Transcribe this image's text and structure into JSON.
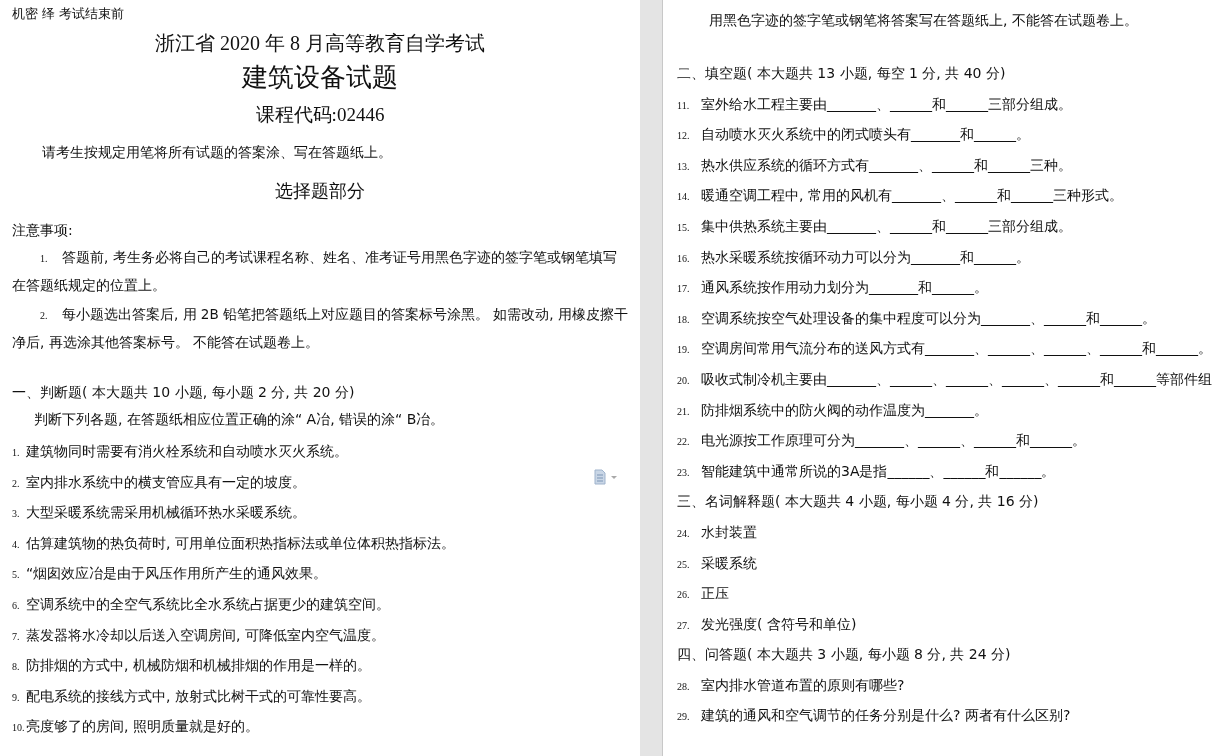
{
  "left_page": {
    "header_note": "机密  绎  考试结束前",
    "exam_title": "浙江省 2020 年 8 月高等教育自学考试",
    "subject_title": "建筑设备试题",
    "course_code": "课程代码:02446",
    "instruction": "请考生按规定用笔将所有试题的答案涂、写在答题纸上。",
    "part_title": "选择题部分",
    "notes_heading": "注意事项:",
    "notes": [
      {
        "number": "1.",
        "text": "答题前, 考生务必将自己的考试课程名称、姓名、准考证号用黑色字迹的签字笔或钢笔填写在答题纸规定的位置上。"
      },
      {
        "number": "2.",
        "text": "每小题选出答案后, 用 2B 铅笔把答题纸上对应题目的答案标号涂黑。 如需改动, 用橡皮擦干净后, 再选涂其他答案标号。 不能答在试题卷上。"
      }
    ],
    "section_heading": "一、判断题( 本大题共 10 小题, 每小题 2 分, 共 20 分)",
    "section_instruction": "判断下列各题, 在答题纸相应位置正确的涂“ A冶, 错误的涂“ B冶。",
    "questions": [
      {
        "number": "1.",
        "text": "建筑物同时需要有消火栓系统和自动喷水灭火系统。"
      },
      {
        "number": "2.",
        "text": "室内排水系统中的横支管应具有一定的坡度。"
      },
      {
        "number": "3.",
        "text": "大型采暖系统需采用机械循环热水采暖系统。"
      },
      {
        "number": "4.",
        "text": "估算建筑物的热负荷时, 可用单位面积热指标法或单位体积热指标法。"
      },
      {
        "number": "5.",
        "text": "“烟囱效应冶是由于风压作用所产生的通风效果。"
      },
      {
        "number": "6.",
        "text": "空调系统中的全空气系统比全水系统占据更少的建筑空间。"
      },
      {
        "number": "7.",
        "text": "蒸发器将水冷却以后送入空调房间, 可降低室内空气温度。"
      },
      {
        "number": "8.",
        "text": "防排烟的方式中, 机械防烟和机械排烟的作用是一样的。"
      },
      {
        "number": "9.",
        "text": "配电系统的接线方式中, 放射式比树干式的可靠性要高。"
      },
      {
        "number": "10.",
        "text": "亮度够了的房间, 照明质量就是好的。"
      }
    ]
  },
  "right_page": {
    "note": "用黑色字迹的签字笔或钢笔将答案写在答题纸上, 不能答在试题卷上。",
    "sections": [
      {
        "heading": "二、填空题( 本大题共 13 小题, 每空 1 分, 共 40 分)",
        "questions": [
          {
            "number": "11.",
            "text": "室外给水工程主要由_______、______和______三部分组成。"
          },
          {
            "number": "12.",
            "text": "自动喷水灭火系统中的闭式喷头有_______和______。"
          },
          {
            "number": "13.",
            "text": "热水供应系统的循环方式有_______、______和______三种。"
          },
          {
            "number": "14.",
            "text": "暖通空调工程中, 常用的风机有_______、______和______三种形式。"
          },
          {
            "number": "15.",
            "text": "集中供热系统主要由_______、______和______三部分组成。"
          },
          {
            "number": "16.",
            "text": "热水采暖系统按循环动力可以分为_______和______。"
          },
          {
            "number": "17.",
            "text": "通风系统按作用动力划分为_______和______。"
          },
          {
            "number": "18.",
            "text": "空调系统按空气处理设备的集中程度可以分为_______、______和______。"
          },
          {
            "number": "19.",
            "text": "空调房间常用气流分布的送风方式有_______、______、______、______和______。"
          },
          {
            "number": "20.",
            "text": "吸收式制冷机主要由_______、______、______、______、______和______等部件组"
          },
          {
            "number": "21.",
            "text": "防排烟系统中的防火阀的动作温度为_______。"
          },
          {
            "number": "22.",
            "text": "电光源按工作原理可分为_______、______、______和______。"
          },
          {
            "number": "23.",
            "text": "智能建筑中通常所说的3A是指______、______和______。"
          }
        ]
      },
      {
        "heading": "三、名词解释题( 本大题共 4 小题, 每小题 4 分, 共 16 分)",
        "questions": [
          {
            "number": "24.",
            "text": "水封装置"
          },
          {
            "number": "25.",
            "text": "采暖系统"
          },
          {
            "number": "26.",
            "text": "正压"
          },
          {
            "number": "27.",
            "text": "发光强度( 含符号和单位)"
          }
        ]
      },
      {
        "heading": "四、问答题( 本大题共 3 小题, 每小题 8 分, 共 24 分)",
        "questions": [
          {
            "number": "28.",
            "text": "室内排水管道布置的原则有哪些?"
          },
          {
            "number": "29.",
            "text": "建筑的通风和空气调节的任务分别是什么? 两者有什么区别?"
          }
        ]
      }
    ]
  }
}
